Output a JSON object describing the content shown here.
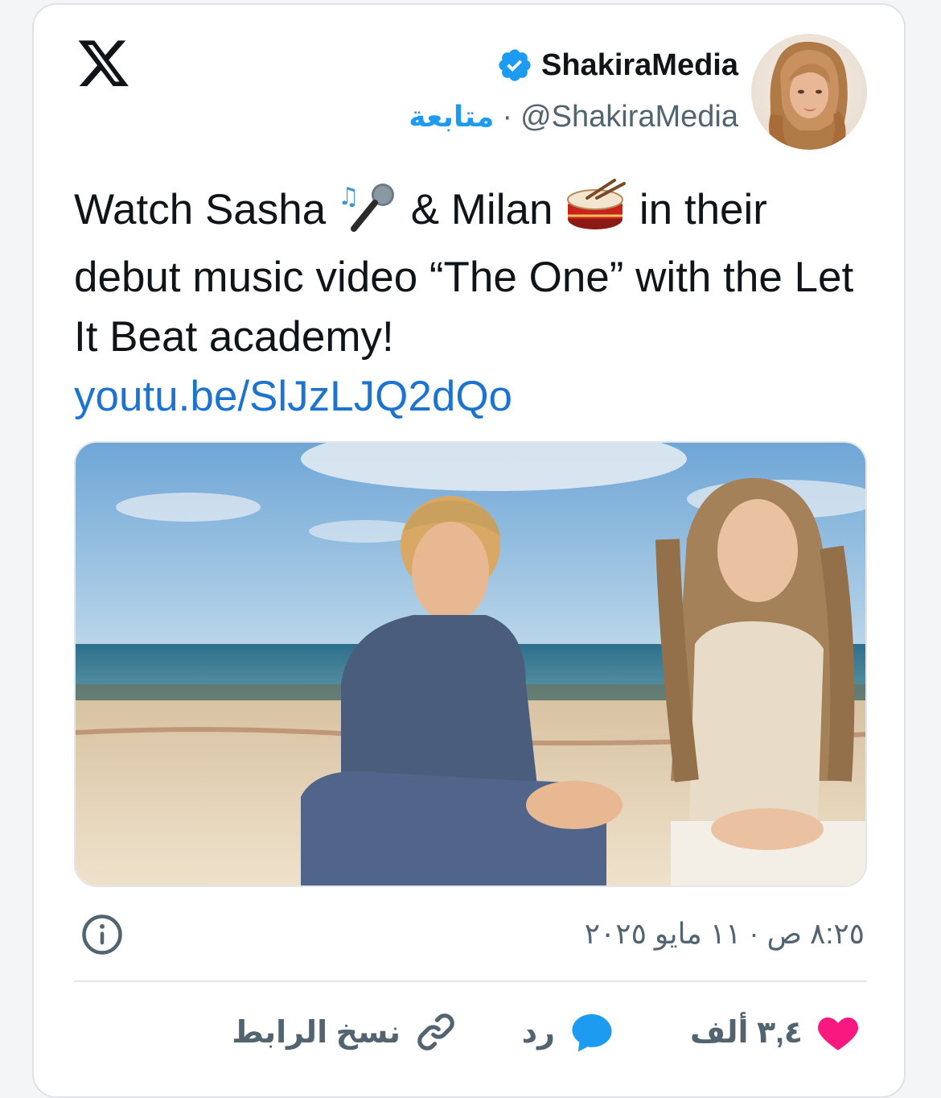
{
  "header": {
    "display_name": "ShakiraMedia",
    "handle": "@ShakiraMedia",
    "separator": "·",
    "follow_label": "متابعة"
  },
  "tweet": {
    "text_part1": "Watch Sasha ",
    "text_part2": " & Milan ",
    "text_part3": " in their debut music video “The One” with the Let It Beat academy!",
    "link": "youtu.be/SlJzLJQ2dQo",
    "emoji_1": "🎤",
    "emoji_2": "🥁"
  },
  "meta": {
    "timestamp": "٨:٢٥ ص · ١١ مايو ٢٠٢٥"
  },
  "actions": {
    "like_count": "٣,٤ ألف",
    "reply_label": "رد",
    "copy_link_label": "نسخ الرابط"
  },
  "colors": {
    "accent": "#1d9bf0",
    "like": "#f91880",
    "text": "#0f1419",
    "secondary": "#536471"
  },
  "icons": [
    "x-logo-icon",
    "verified-badge-icon",
    "info-icon",
    "heart-icon",
    "reply-bubble-icon",
    "link-icon"
  ]
}
